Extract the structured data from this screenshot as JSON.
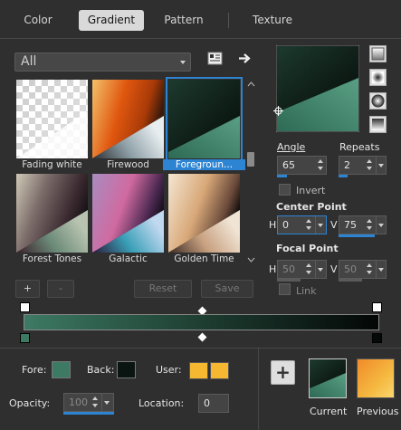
{
  "tabs": [
    {
      "label": "Color",
      "active": false
    },
    {
      "label": "Gradient",
      "active": true
    },
    {
      "label": "Pattern",
      "active": false
    },
    {
      "label": "Texture",
      "active": false
    }
  ],
  "filter": {
    "value": "All"
  },
  "gradients": [
    {
      "name": "Fading white",
      "selected": false
    },
    {
      "name": "Firewood",
      "selected": false
    },
    {
      "name": "Foregroun...",
      "selected": true
    },
    {
      "name": "Forest Tones",
      "selected": false
    },
    {
      "name": "Galactic",
      "selected": false
    },
    {
      "name": "Golden Time",
      "selected": false
    }
  ],
  "toolbar": {
    "add": "+",
    "remove": "-",
    "reset": "Reset",
    "save": "Save"
  },
  "angle": {
    "label": "Angle",
    "value": "65"
  },
  "repeats": {
    "label": "Repeats",
    "value": "2"
  },
  "invert": {
    "label": "Invert",
    "checked": false
  },
  "center_point": {
    "title": "Center Point",
    "h_label": "H",
    "h_value": "0",
    "v_label": "V",
    "v_value": "75"
  },
  "focal_point": {
    "title": "Focal Point",
    "h_label": "H",
    "h_value": "50",
    "v_label": "V",
    "v_value": "50"
  },
  "link": {
    "label": "Link",
    "checked": false
  },
  "bottom": {
    "fore_label": "Fore:",
    "back_label": "Back:",
    "user_label": "User:",
    "opacity_label": "Opacity:",
    "opacity_value": "100",
    "location_label": "Location:",
    "location_value": "0",
    "current_label": "Current",
    "previous_label": "Previous",
    "add_button": "+"
  },
  "colors": {
    "accent": "#2d84d2",
    "fore": "#3d7a64",
    "back": "#0a1410",
    "user1": "#f5b830",
    "user2": "#f5b830"
  }
}
